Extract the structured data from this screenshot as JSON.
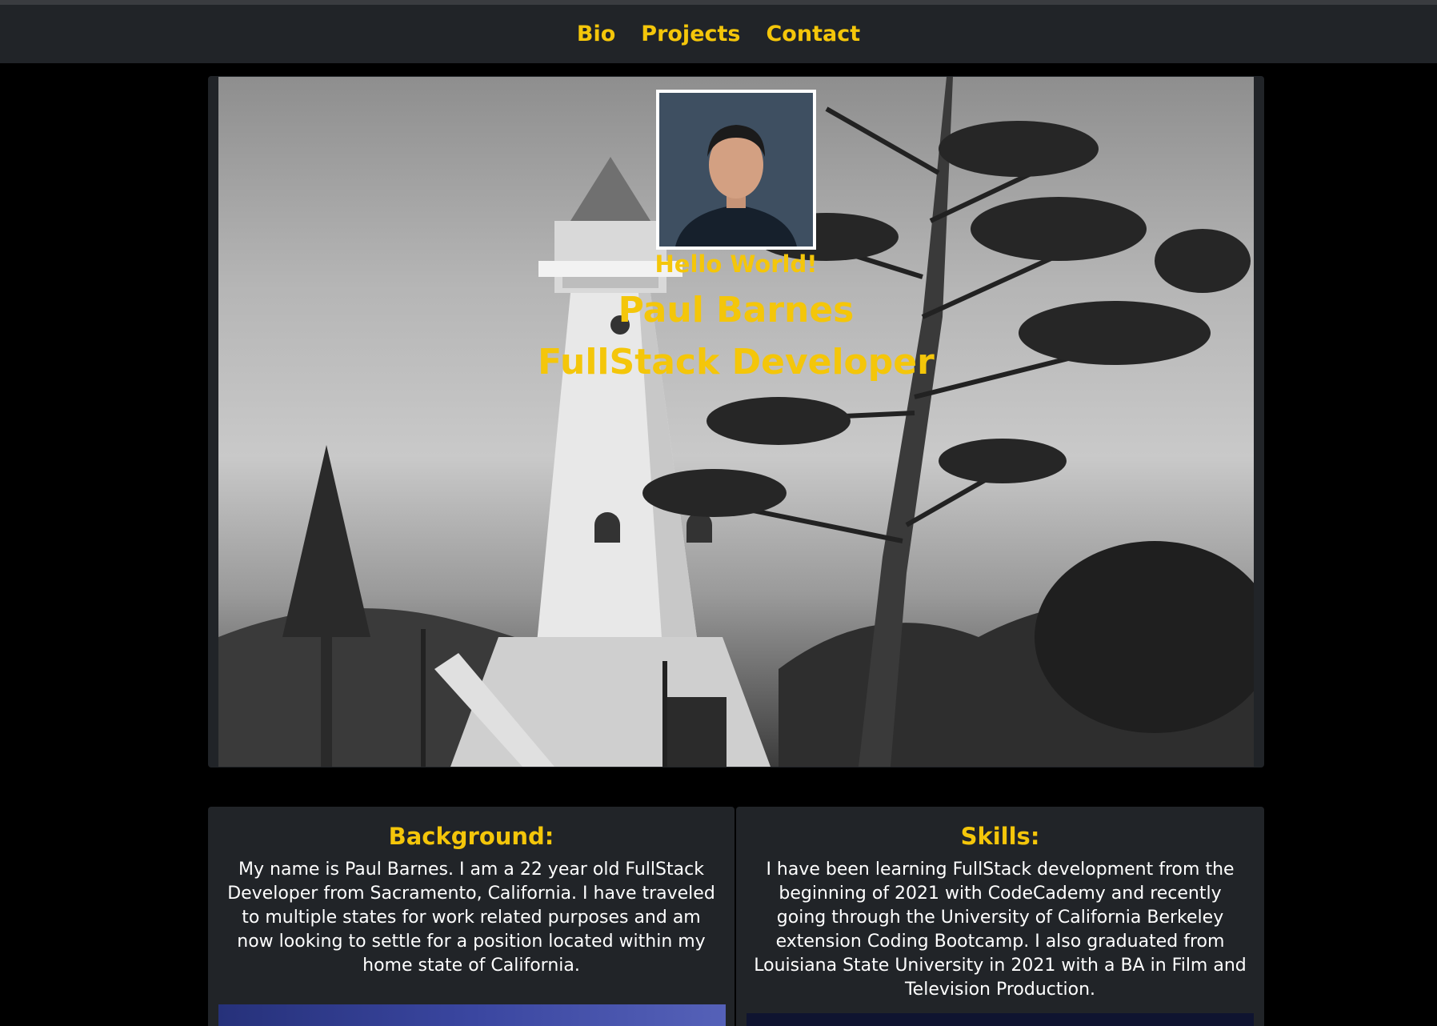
{
  "nav": {
    "links": [
      "Bio",
      "Projects",
      "Contact"
    ]
  },
  "hero": {
    "greeting": "Hello World!",
    "name": "Paul Barnes",
    "role": "FullStack Developer"
  },
  "cards": {
    "background": {
      "title": "Background:",
      "body": "My name is Paul Barnes. I am a 22 year old FullStack Developer from Sacramento, California. I have traveled to multiple states for work related purposes and am now looking to settle for a position located within my home state of California."
    },
    "skills": {
      "title": "Skills:",
      "body": "I have been learning FullStack development from the beginning of 2021 with CodeCademy and recently going through the University of California Berkeley extension Coding Bootcamp. I also graduated from Louisiana State University in 2021 with a BA in Film and Television Production."
    }
  },
  "colors": {
    "accent": "#f4c60a",
    "navbar": "#212428",
    "page": "#000000",
    "card": "#212428"
  }
}
